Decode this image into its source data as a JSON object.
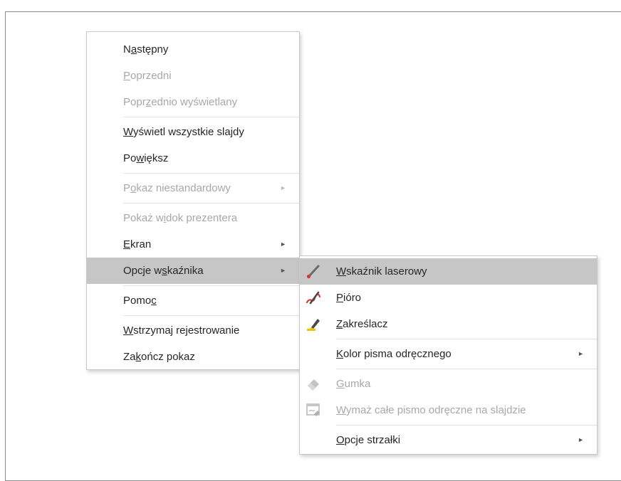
{
  "main_menu": {
    "items": [
      {
        "pre": "N",
        "key": "a",
        "post": "stępny",
        "disabled": false
      },
      {
        "pre": "",
        "key": "P",
        "post": "oprzedni",
        "disabled": true
      },
      {
        "pre": "Popr",
        "key": "z",
        "post": "ednio wyświetlany",
        "disabled": true
      },
      {
        "pre": "",
        "key": "W",
        "post": "yświetl wszystkie slajdy",
        "disabled": false
      },
      {
        "pre": "Po",
        "key": "w",
        "post": "iększ",
        "disabled": false
      },
      {
        "pre": "P",
        "key": "o",
        "post": "kaz niestandardowy",
        "disabled": true
      },
      {
        "pre": "Pokaż w",
        "key": "i",
        "post": "dok prezentera",
        "disabled": true
      },
      {
        "pre": "",
        "key": "E",
        "post": "kran",
        "disabled": false
      },
      {
        "pre": "Opcje w",
        "key": "s",
        "post": "kaźnika",
        "disabled": false
      },
      {
        "pre": "Pomo",
        "key": "c",
        "post": "",
        "disabled": false
      },
      {
        "pre": "",
        "key": "W",
        "post": "strzymaj rejestrowanie",
        "disabled": false
      },
      {
        "pre": "Za",
        "key": "k",
        "post": "ończ pokaz",
        "disabled": false
      }
    ],
    "arrow_glyph": "►"
  },
  "sub_menu": {
    "items": [
      {
        "pre": "",
        "key": "W",
        "post": "skaźnik laserowy",
        "icon": "laser-pointer-icon",
        "disabled": false
      },
      {
        "pre": "",
        "key": "P",
        "post": "ióro",
        "icon": "pen-icon",
        "disabled": false
      },
      {
        "pre": "",
        "key": "Z",
        "post": "akreślacz",
        "icon": "highlighter-icon",
        "disabled": false
      },
      {
        "pre": "",
        "key": "K",
        "post": "olor pisma odręcznego",
        "icon": "",
        "disabled": false
      },
      {
        "pre": "",
        "key": "G",
        "post": "umka",
        "icon": "eraser-icon",
        "disabled": true
      },
      {
        "pre": "",
        "key": "W",
        "post": "ymaż całe pismo odręczne na slajdzie",
        "icon": "erase-all-ink-icon",
        "disabled": true
      },
      {
        "pre": "",
        "key": "O",
        "post": "pcje strzałki",
        "icon": "",
        "disabled": false
      }
    ]
  },
  "colors": {
    "hover": "#c6c6c6",
    "text": "#262626",
    "disabled_text": "#a8a8a8",
    "pen_red": "#d33b2c",
    "highlighter_yellow": "#f2c200"
  }
}
